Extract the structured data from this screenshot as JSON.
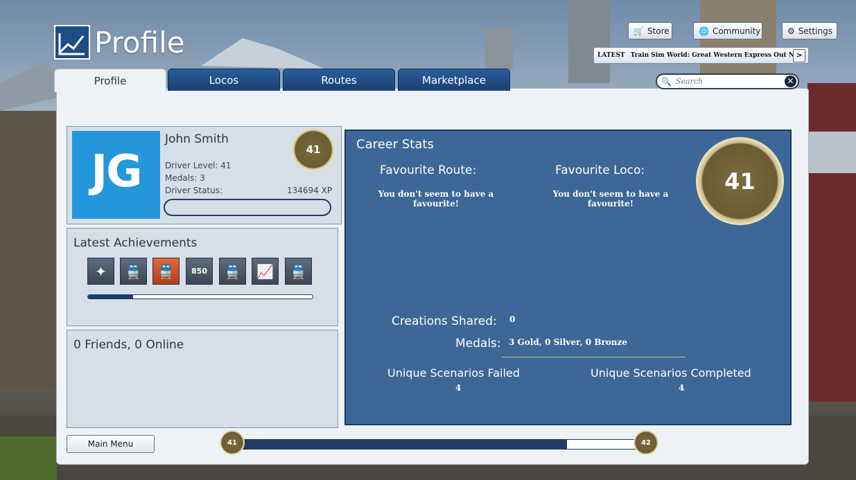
{
  "header": {
    "title": "Profile"
  },
  "tabs": [
    {
      "label": "Profile",
      "active": true
    },
    {
      "label": "Locos",
      "active": false
    },
    {
      "label": "Routes",
      "active": false
    },
    {
      "label": "Marketplace",
      "active": false
    }
  ],
  "top_buttons": {
    "store": "Store",
    "community": "Community",
    "settings": "Settings"
  },
  "news": {
    "tag": "LATEST",
    "text": "Train Sim World: Great Western Express Out Now!",
    "arrow": ">"
  },
  "search": {
    "placeholder": "Search"
  },
  "profile": {
    "initials": "JG",
    "name": "John Smith",
    "driver_level": "Driver Level: 41",
    "medals": "Medals: 3",
    "driver_status": "Driver Status:",
    "xp": "134694 XP",
    "level_badge": "41"
  },
  "achievements": {
    "title": "Latest Achievements",
    "icons": [
      "sparkler-icon",
      "train-icon",
      "train-icon-highlight",
      "850-badge-icon",
      "train-icon",
      "chart-icon",
      "train-icon"
    ],
    "progress": 0.2
  },
  "friends": {
    "summary": "0 Friends, 0 Online"
  },
  "career": {
    "title": "Career Stats",
    "favourite_route_label": "Favourite Route:",
    "favourite_route_value": "You don't seem to have a favourite!",
    "favourite_loco_label": "Favourite Loco:",
    "favourite_loco_value": "You don't seem to have a favourite!",
    "level_badge": "41",
    "creations_label": "Creations Shared:",
    "creations_value": "0",
    "medals_label": "Medals:",
    "medals_value": "3 Gold, 0 Silver, 0 Bronze",
    "failed_label": "Unique Scenarios Failed",
    "failed_value": "4",
    "completed_label": "Unique Scenarios Completed",
    "completed_value": "4"
  },
  "footer": {
    "main_menu": "Main Menu",
    "current_level": "41",
    "next_level": "42",
    "level_progress": 0.81
  },
  "colors": {
    "accent": "#1e3c66",
    "panel_blue": "#3c6796",
    "avatar_blue": "#2596dc"
  }
}
